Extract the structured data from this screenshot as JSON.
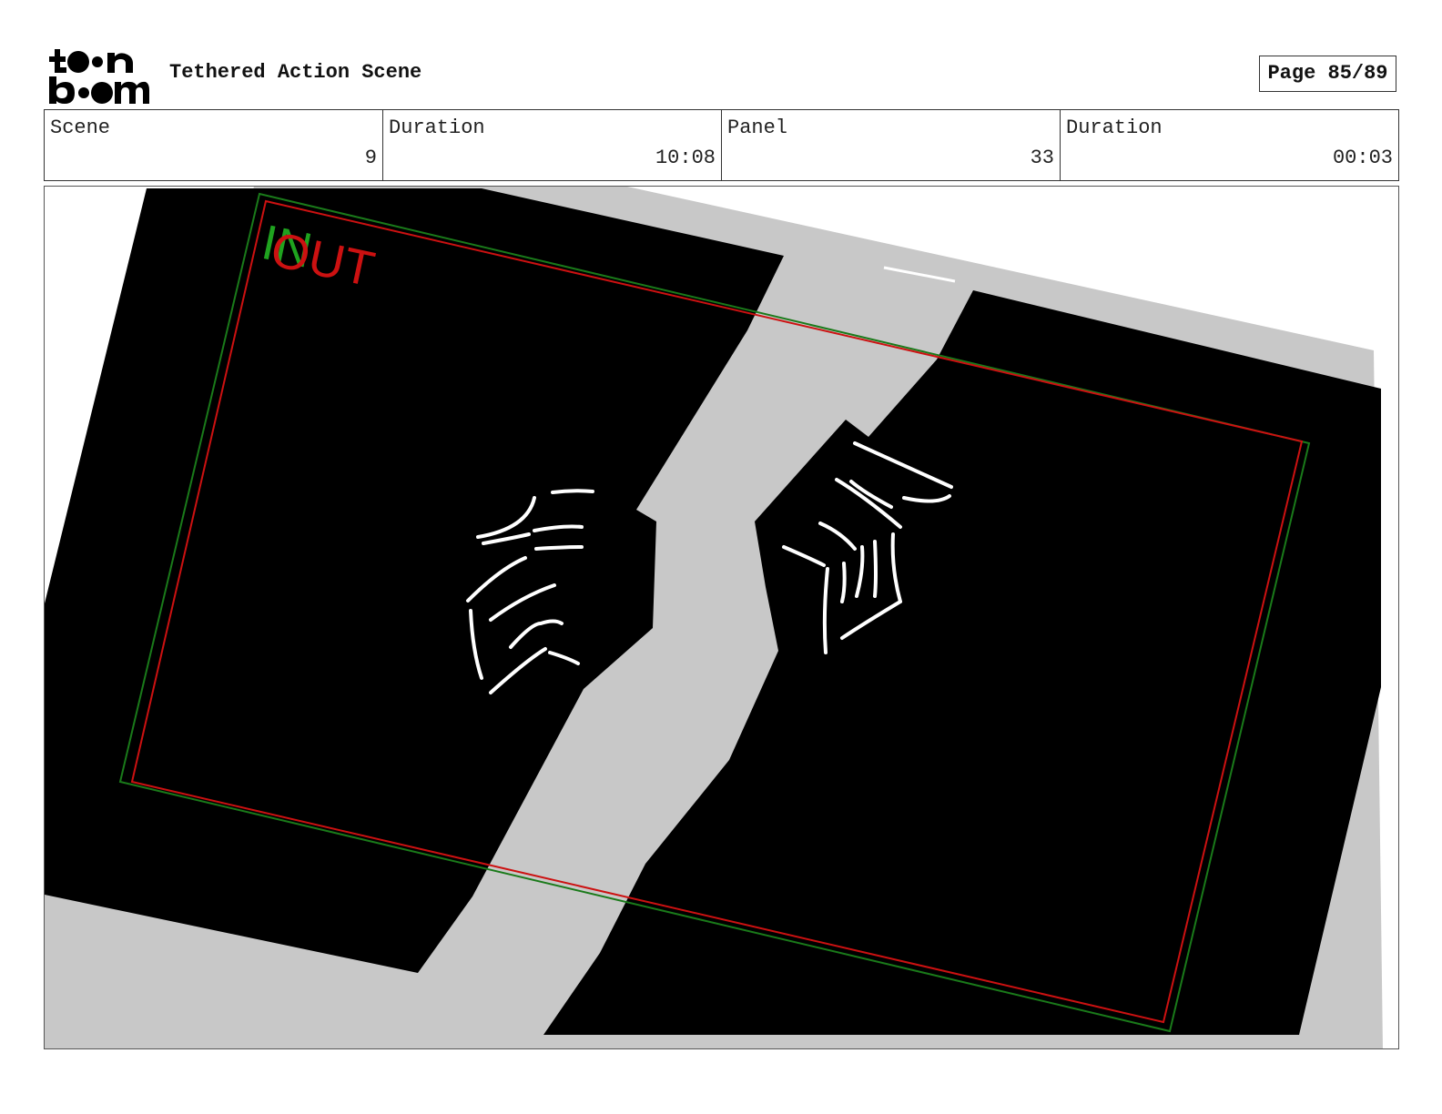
{
  "header": {
    "logo_alt": "toon boom",
    "title": "Tethered Action Scene",
    "page_label": "Page 85/89"
  },
  "info": {
    "scene_label": "Scene",
    "scene_value": "9",
    "scene_duration_label": "Duration",
    "scene_duration_value": "10:08",
    "panel_label": "Panel",
    "panel_value": "33",
    "panel_duration_label": "Duration",
    "panel_duration_value": "00:03"
  },
  "panel_image": {
    "in_marker": "IN",
    "out_marker": "OUT",
    "in_color": "#1fa31f",
    "out_color": "#cc1111",
    "colors": {
      "dark": "#000000",
      "gap": "#c8c8c8",
      "lines": "#ffffff"
    }
  }
}
